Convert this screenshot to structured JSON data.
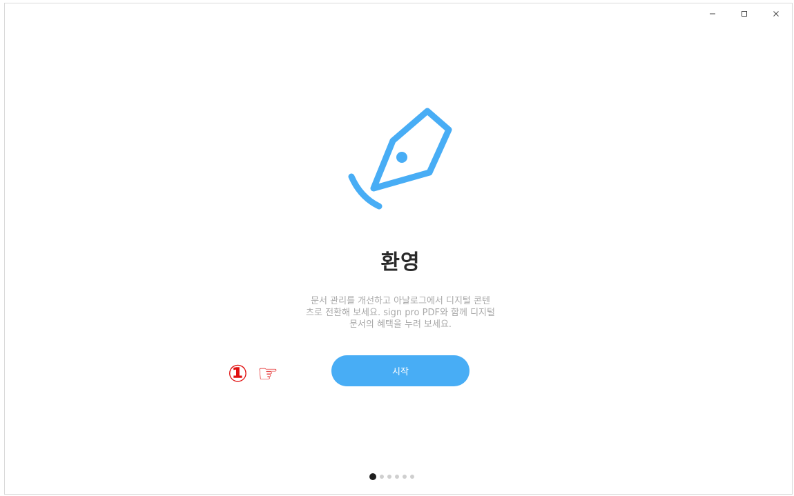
{
  "window": {
    "controls": [
      {
        "name": "minimize-button",
        "icon": "minimize-icon"
      },
      {
        "name": "maximize-button",
        "icon": "maximize-icon"
      },
      {
        "name": "close-button",
        "icon": "close-icon"
      }
    ]
  },
  "welcome": {
    "logo_icon": "pen-nib-icon",
    "title": "환영",
    "description_lines": [
      "문서 관리를 개선하고 아날로그에서 디지털 콘텐",
      "츠로 전환해 보세요. sign pro PDF와 함께 디지털",
      "문서의 혜택을 누려 보세요."
    ],
    "start_label": "시작"
  },
  "annotation": {
    "number": "①",
    "pointer": "☞"
  },
  "pager": {
    "total": 6,
    "active_index": 0
  },
  "colors": {
    "accent": "#48adf5",
    "annotation": "#e01010",
    "title": "#2a2a2a",
    "description": "#a9a9a9",
    "dot_active": "#1e1e1e",
    "dot_inactive": "#cfcfcf"
  }
}
